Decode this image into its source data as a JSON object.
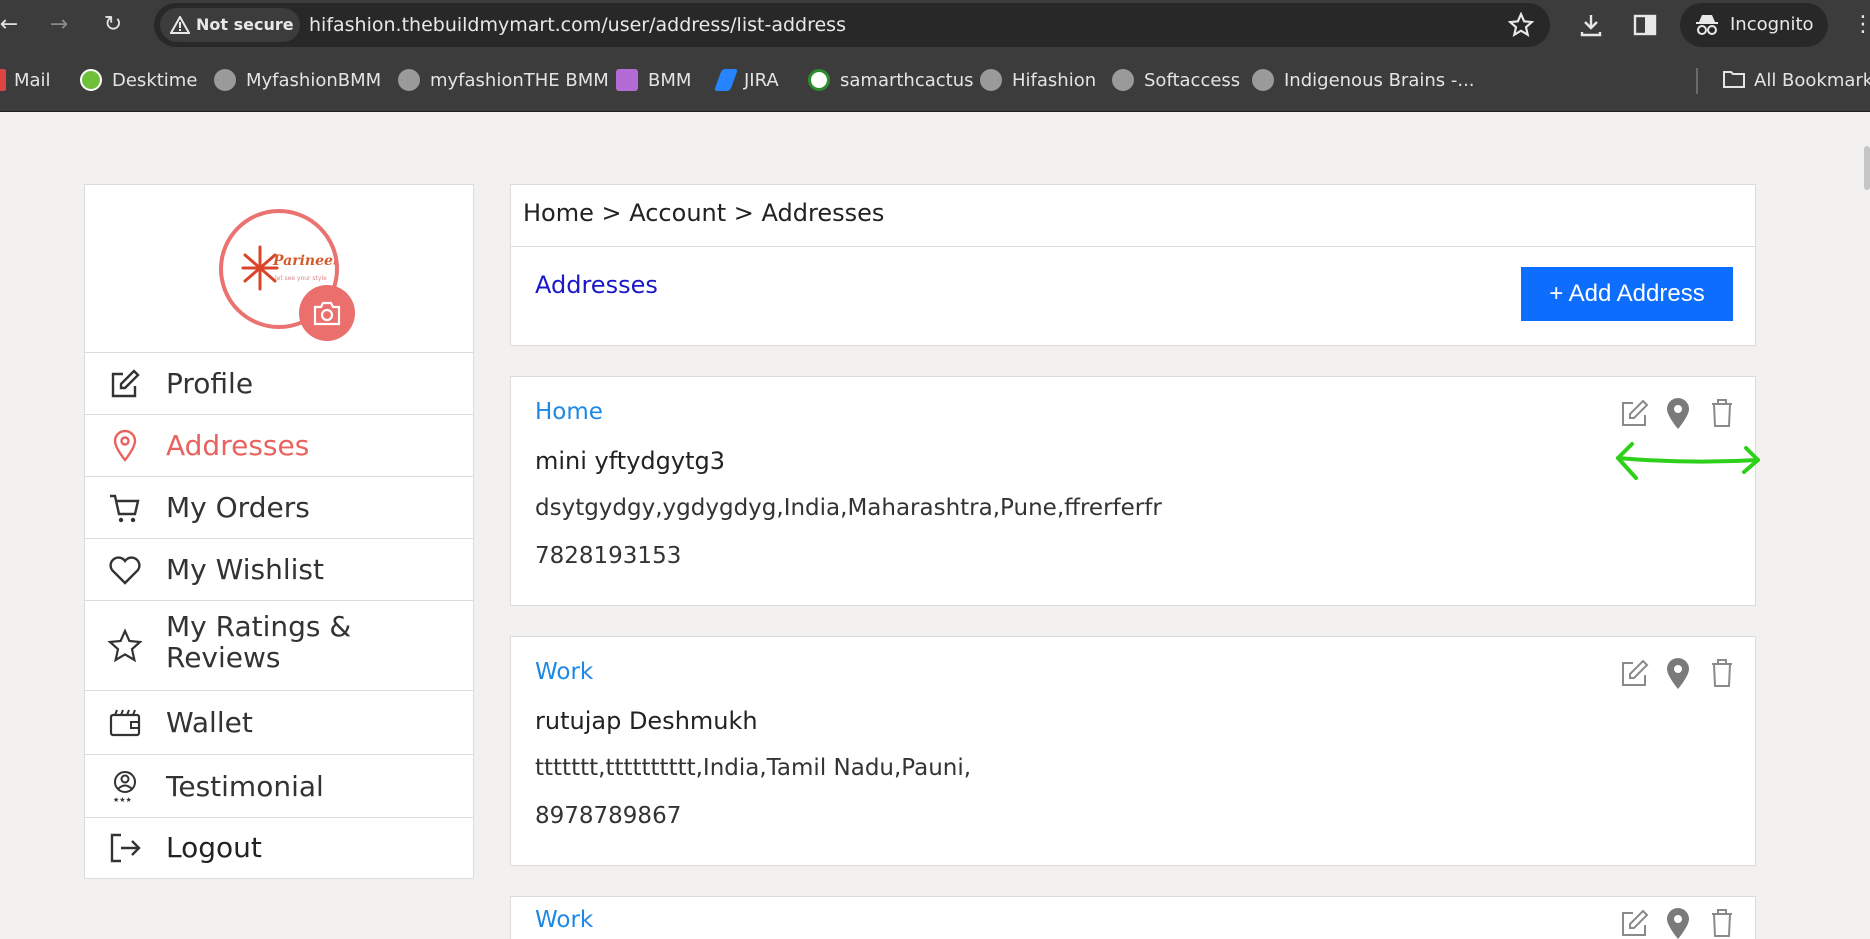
{
  "browser": {
    "security_label": "Not secure",
    "url": "hifashion.thebuildmymart.com/user/address/list-address",
    "incognito_label": "Incognito",
    "bookmarks": [
      {
        "label": "Mail"
      },
      {
        "label": "Desktime"
      },
      {
        "label": "MyfashionBMM"
      },
      {
        "label": "myfashionTHE BMM"
      },
      {
        "label": "BMM"
      },
      {
        "label": "JIRA"
      },
      {
        "label": "samarthcactus"
      },
      {
        "label": "Hifashion"
      },
      {
        "label": "Softaccess"
      },
      {
        "label": "Indigenous Brains -..."
      }
    ],
    "all_bookmarks_label": "All Bookmarks"
  },
  "profile": {
    "logo_text": "Parineeti",
    "logo_sub": "let see your style"
  },
  "sidebar": {
    "items": [
      {
        "label": "Profile",
        "icon": "edit-icon"
      },
      {
        "label": "Addresses",
        "icon": "location-pin-icon"
      },
      {
        "label": "My Orders",
        "icon": "cart-icon"
      },
      {
        "label": "My Wishlist",
        "icon": "heart-icon"
      },
      {
        "label": "My Ratings &",
        "label2": "Reviews",
        "icon": "star-icon"
      },
      {
        "label": "Wallet",
        "icon": "wallet-icon"
      },
      {
        "label": "Testimonial",
        "icon": "testimonial-icon"
      },
      {
        "label": "Logout",
        "icon": "logout-icon"
      }
    ],
    "active_color": "#e9625f"
  },
  "breadcrumb": {
    "text": "Home > Account > Addresses"
  },
  "header": {
    "title": "Addresses",
    "add_button": "+ Add Address"
  },
  "addresses": [
    {
      "type": "Home",
      "name": "mini yftydgytg3",
      "line": "dsytgydgy,ygdygdyg,India,Maharashtra,Pune,ffrerferfr",
      "phone": "7828193153"
    },
    {
      "type": "Work",
      "name": "rutujap Deshmukh",
      "line": "ttttttt,tttttttttt,India,Tamil Nadu,Pauni,",
      "phone": "8978789867"
    },
    {
      "type": "Work"
    }
  ],
  "colors": {
    "primary_button": "#0d6efd",
    "address_type": "#1e88e5",
    "header_title": "#1a17c9",
    "annotation_arrow": "#2ed11a"
  }
}
